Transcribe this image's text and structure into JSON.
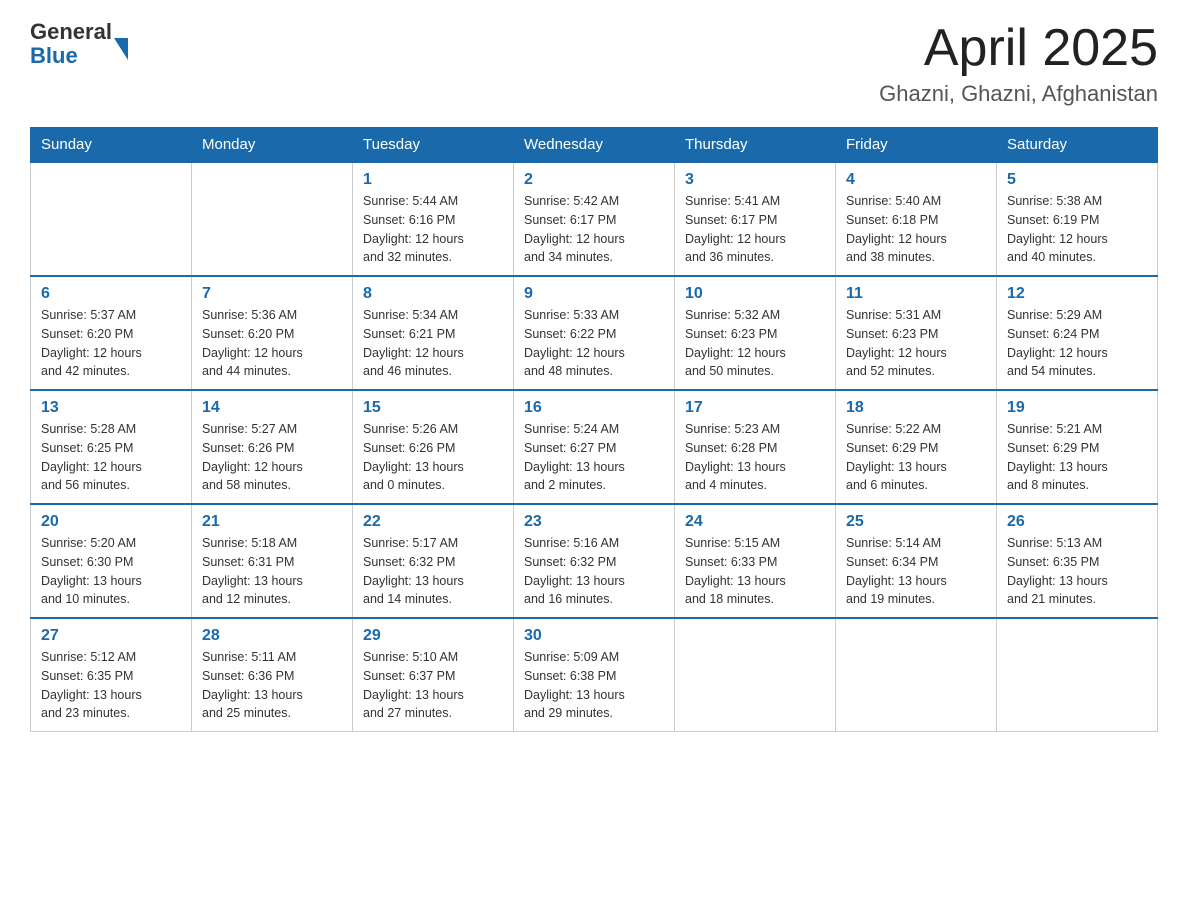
{
  "header": {
    "logo": {
      "general": "General",
      "blue": "Blue"
    },
    "title": "April 2025",
    "location": "Ghazni, Ghazni, Afghanistan"
  },
  "weekdays": [
    "Sunday",
    "Monday",
    "Tuesday",
    "Wednesday",
    "Thursday",
    "Friday",
    "Saturday"
  ],
  "weeks": [
    [
      {
        "day": "",
        "info": ""
      },
      {
        "day": "",
        "info": ""
      },
      {
        "day": "1",
        "info": "Sunrise: 5:44 AM\nSunset: 6:16 PM\nDaylight: 12 hours\nand 32 minutes."
      },
      {
        "day": "2",
        "info": "Sunrise: 5:42 AM\nSunset: 6:17 PM\nDaylight: 12 hours\nand 34 minutes."
      },
      {
        "day": "3",
        "info": "Sunrise: 5:41 AM\nSunset: 6:17 PM\nDaylight: 12 hours\nand 36 minutes."
      },
      {
        "day": "4",
        "info": "Sunrise: 5:40 AM\nSunset: 6:18 PM\nDaylight: 12 hours\nand 38 minutes."
      },
      {
        "day": "5",
        "info": "Sunrise: 5:38 AM\nSunset: 6:19 PM\nDaylight: 12 hours\nand 40 minutes."
      }
    ],
    [
      {
        "day": "6",
        "info": "Sunrise: 5:37 AM\nSunset: 6:20 PM\nDaylight: 12 hours\nand 42 minutes."
      },
      {
        "day": "7",
        "info": "Sunrise: 5:36 AM\nSunset: 6:20 PM\nDaylight: 12 hours\nand 44 minutes."
      },
      {
        "day": "8",
        "info": "Sunrise: 5:34 AM\nSunset: 6:21 PM\nDaylight: 12 hours\nand 46 minutes."
      },
      {
        "day": "9",
        "info": "Sunrise: 5:33 AM\nSunset: 6:22 PM\nDaylight: 12 hours\nand 48 minutes."
      },
      {
        "day": "10",
        "info": "Sunrise: 5:32 AM\nSunset: 6:23 PM\nDaylight: 12 hours\nand 50 minutes."
      },
      {
        "day": "11",
        "info": "Sunrise: 5:31 AM\nSunset: 6:23 PM\nDaylight: 12 hours\nand 52 minutes."
      },
      {
        "day": "12",
        "info": "Sunrise: 5:29 AM\nSunset: 6:24 PM\nDaylight: 12 hours\nand 54 minutes."
      }
    ],
    [
      {
        "day": "13",
        "info": "Sunrise: 5:28 AM\nSunset: 6:25 PM\nDaylight: 12 hours\nand 56 minutes."
      },
      {
        "day": "14",
        "info": "Sunrise: 5:27 AM\nSunset: 6:26 PM\nDaylight: 12 hours\nand 58 minutes."
      },
      {
        "day": "15",
        "info": "Sunrise: 5:26 AM\nSunset: 6:26 PM\nDaylight: 13 hours\nand 0 minutes."
      },
      {
        "day": "16",
        "info": "Sunrise: 5:24 AM\nSunset: 6:27 PM\nDaylight: 13 hours\nand 2 minutes."
      },
      {
        "day": "17",
        "info": "Sunrise: 5:23 AM\nSunset: 6:28 PM\nDaylight: 13 hours\nand 4 minutes."
      },
      {
        "day": "18",
        "info": "Sunrise: 5:22 AM\nSunset: 6:29 PM\nDaylight: 13 hours\nand 6 minutes."
      },
      {
        "day": "19",
        "info": "Sunrise: 5:21 AM\nSunset: 6:29 PM\nDaylight: 13 hours\nand 8 minutes."
      }
    ],
    [
      {
        "day": "20",
        "info": "Sunrise: 5:20 AM\nSunset: 6:30 PM\nDaylight: 13 hours\nand 10 minutes."
      },
      {
        "day": "21",
        "info": "Sunrise: 5:18 AM\nSunset: 6:31 PM\nDaylight: 13 hours\nand 12 minutes."
      },
      {
        "day": "22",
        "info": "Sunrise: 5:17 AM\nSunset: 6:32 PM\nDaylight: 13 hours\nand 14 minutes."
      },
      {
        "day": "23",
        "info": "Sunrise: 5:16 AM\nSunset: 6:32 PM\nDaylight: 13 hours\nand 16 minutes."
      },
      {
        "day": "24",
        "info": "Sunrise: 5:15 AM\nSunset: 6:33 PM\nDaylight: 13 hours\nand 18 minutes."
      },
      {
        "day": "25",
        "info": "Sunrise: 5:14 AM\nSunset: 6:34 PM\nDaylight: 13 hours\nand 19 minutes."
      },
      {
        "day": "26",
        "info": "Sunrise: 5:13 AM\nSunset: 6:35 PM\nDaylight: 13 hours\nand 21 minutes."
      }
    ],
    [
      {
        "day": "27",
        "info": "Sunrise: 5:12 AM\nSunset: 6:35 PM\nDaylight: 13 hours\nand 23 minutes."
      },
      {
        "day": "28",
        "info": "Sunrise: 5:11 AM\nSunset: 6:36 PM\nDaylight: 13 hours\nand 25 minutes."
      },
      {
        "day": "29",
        "info": "Sunrise: 5:10 AM\nSunset: 6:37 PM\nDaylight: 13 hours\nand 27 minutes."
      },
      {
        "day": "30",
        "info": "Sunrise: 5:09 AM\nSunset: 6:38 PM\nDaylight: 13 hours\nand 29 minutes."
      },
      {
        "day": "",
        "info": ""
      },
      {
        "day": "",
        "info": ""
      },
      {
        "day": "",
        "info": ""
      }
    ]
  ]
}
